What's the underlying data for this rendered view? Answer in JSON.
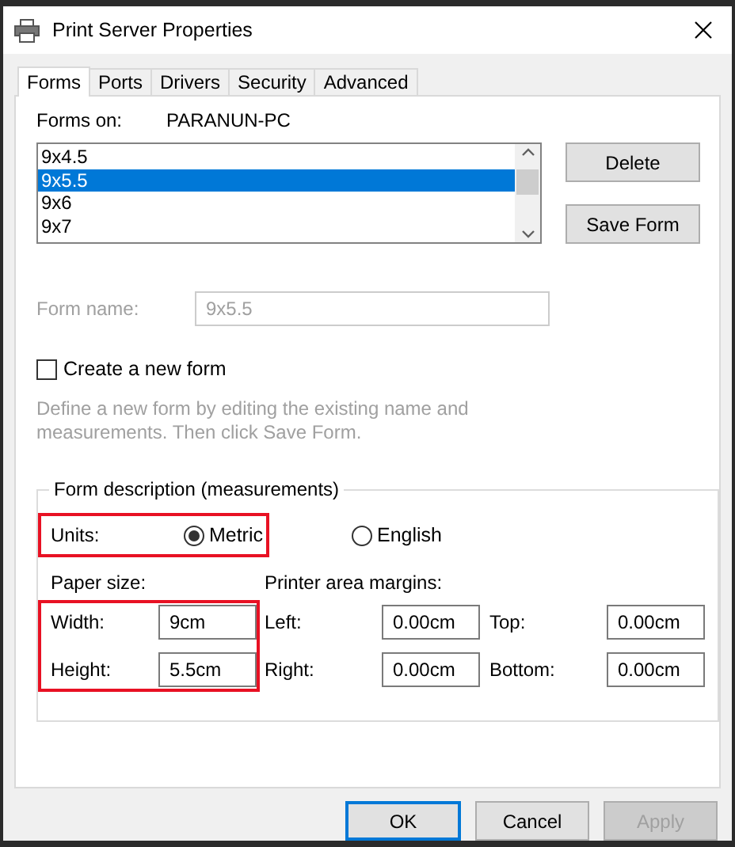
{
  "window": {
    "title": "Print Server Properties"
  },
  "tabs": [
    {
      "label": "Forms",
      "selected": true
    },
    {
      "label": "Ports",
      "selected": false
    },
    {
      "label": "Drivers",
      "selected": false
    },
    {
      "label": "Security",
      "selected": false
    },
    {
      "label": "Advanced",
      "selected": false
    }
  ],
  "forms_on": {
    "label": "Forms on:",
    "server": "PARANUN-PC"
  },
  "forms_list": [
    {
      "label": "9x4.5",
      "selected": false
    },
    {
      "label": "9x5.5",
      "selected": true
    },
    {
      "label": "9x6",
      "selected": false
    },
    {
      "label": "9x7",
      "selected": false
    }
  ],
  "list_buttons": [
    "Delete",
    "Save Form"
  ],
  "form_name": {
    "label": "Form name:",
    "value": "9x5.5",
    "disabled": true
  },
  "create_new": {
    "label": "Create a new form",
    "checked": false
  },
  "hint": "Define a new form by editing the existing name and measurements. Then click Save Form.",
  "description": {
    "title": "Form description (measurements)",
    "units_label": "Units:",
    "units": [
      {
        "label": "Metric",
        "selected": true
      },
      {
        "label": "English",
        "selected": false
      }
    ],
    "paper_size_label": "Paper size:",
    "margins_label": "Printer area margins:",
    "paper": [
      {
        "label": "Width:",
        "value": "9cm"
      },
      {
        "label": "Height:",
        "value": "5.5cm"
      }
    ],
    "margins": [
      {
        "label": "Left:",
        "value": "0.00cm"
      },
      {
        "label": "Top:",
        "value": "0.00cm"
      },
      {
        "label": "Right:",
        "value": "0.00cm"
      },
      {
        "label": "Bottom:",
        "value": "0.00cm"
      }
    ]
  },
  "buttons": [
    {
      "label": "OK",
      "default": true,
      "disabled": false
    },
    {
      "label": "Cancel",
      "default": false,
      "disabled": false
    },
    {
      "label": "Apply",
      "default": false,
      "disabled": true
    }
  ]
}
